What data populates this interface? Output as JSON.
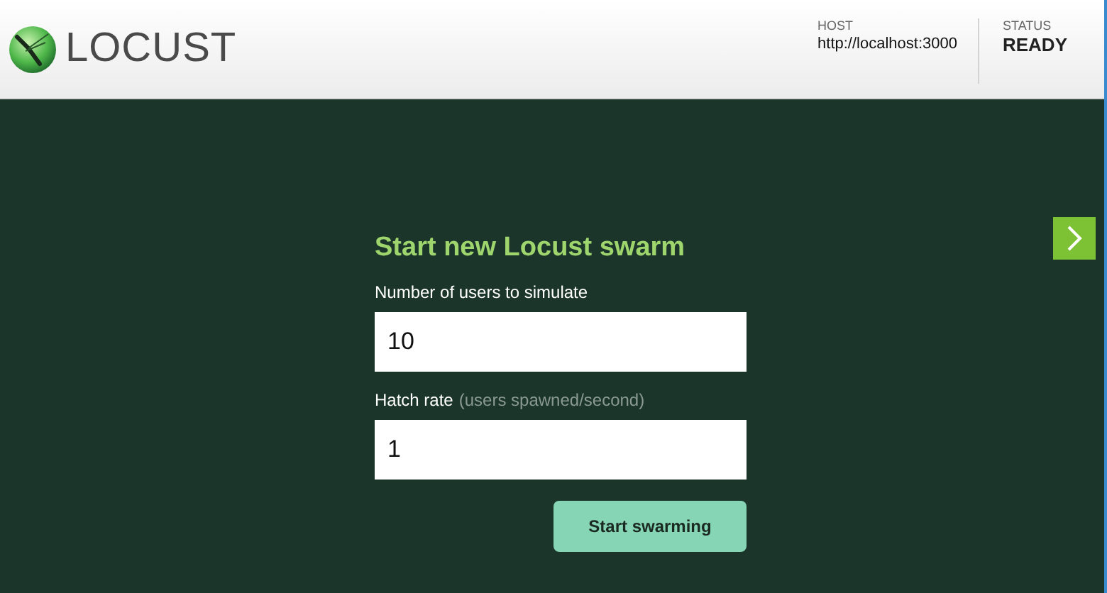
{
  "header": {
    "logo_text": "LOCUST",
    "host_label": "HOST",
    "host": "http://localhost:3000",
    "status_label": "STATUS",
    "status": "READY"
  },
  "form": {
    "title": "Start new Locust swarm",
    "fields": [
      {
        "label": "Number of users to simulate",
        "value": "10"
      },
      {
        "label": "Hatch rate",
        "hint": "(users spawned/second)",
        "value": "1"
      }
    ],
    "submit": "Start swarming"
  }
}
